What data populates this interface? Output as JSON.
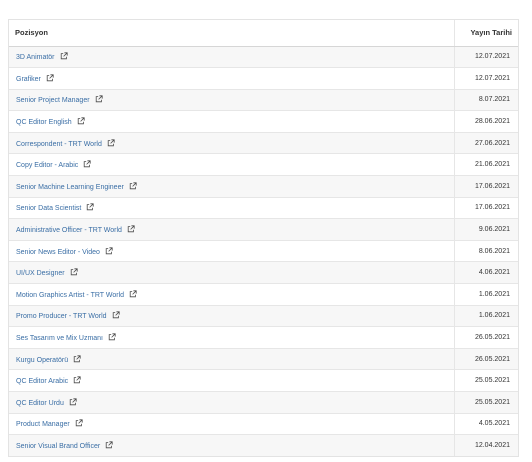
{
  "table": {
    "headers": {
      "position": "Pozisyon",
      "date": "Yayın Tarihi"
    },
    "rows": [
      {
        "title": "3D Animatör",
        "date": "12.07.2021"
      },
      {
        "title": "Grafiker",
        "date": "12.07.2021"
      },
      {
        "title": "Senior Project Manager",
        "date": "8.07.2021"
      },
      {
        "title": "QC Editor English",
        "date": "28.06.2021"
      },
      {
        "title": "Correspondent - TRT World",
        "date": "27.06.2021"
      },
      {
        "title": "Copy Editor - Arabic",
        "date": "21.06.2021"
      },
      {
        "title": "Senior Machine Learning Engineer",
        "date": "17.06.2021"
      },
      {
        "title": "Senior Data Scientist",
        "date": "17.06.2021"
      },
      {
        "title": "Administrative Officer - TRT World",
        "date": "9.06.2021"
      },
      {
        "title": "Senior News Editor - Video",
        "date": "8.06.2021"
      },
      {
        "title": "UI/UX Designer",
        "date": "4.06.2021"
      },
      {
        "title": "Motion Graphics Artist - TRT World",
        "date": "1.06.2021"
      },
      {
        "title": "Promo Producer - TRT World",
        "date": "1.06.2021"
      },
      {
        "title": "Ses Tasarım ve Mix Uzmanı",
        "date": "26.05.2021"
      },
      {
        "title": "Kurgu Operatörü",
        "date": "26.05.2021"
      },
      {
        "title": "QC Editor Arabic",
        "date": "25.05.2021"
      },
      {
        "title": "QC Editor Urdu",
        "date": "25.05.2021"
      },
      {
        "title": "Product Manager",
        "date": "4.05.2021"
      },
      {
        "title": "Senior Visual Brand Officer",
        "date": "12.04.2021"
      }
    ],
    "icon": "external-link-icon"
  }
}
